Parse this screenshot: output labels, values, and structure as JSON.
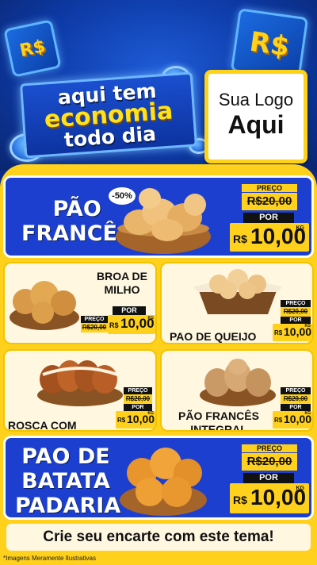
{
  "header": {
    "cube_left_text": "R$",
    "cube_right_text": "R$",
    "coin_text": "$",
    "headline_line1": "aqui tem",
    "headline_line2": "economia",
    "headline_line3": "todo dia",
    "logo_line1": "Sua Logo",
    "logo_line2": "Aqui"
  },
  "products": {
    "pao_frances": {
      "name_line1": "PÃO",
      "name_line2": "FRANCÊS",
      "discount": "-50%",
      "preco_label": "PREÇO",
      "old_price": "R$20,00",
      "por_label": "POR",
      "currency": "R$",
      "price": "10,00",
      "unit": "KG"
    },
    "broa": {
      "name_line1": "BROA DE",
      "name_line2": "MILHO",
      "preco_label": "PREÇO",
      "old_price": "R$20,00",
      "por_label": "POR",
      "currency": "R$",
      "price": "10,00",
      "unit": "KG"
    },
    "queijo": {
      "name": "PAO DE QUEIJO",
      "preco_label": "PREÇO",
      "old_price": "R$20,00",
      "por_label": "POR",
      "currency": "R$",
      "price": "10,00",
      "unit": "KG"
    },
    "rosca": {
      "name": "ROSCA COM CREME",
      "preco_label": "PREÇO",
      "old_price": "R$20,00",
      "por_label": "POR",
      "currency": "R$",
      "price": "10,00",
      "unit": "KG"
    },
    "integral": {
      "name_line1": "PÃO FRANCÊS",
      "name_line2": "INTEGRAL",
      "preco_label": "PREÇO",
      "old_price": "R$20,00",
      "por_label": "POR",
      "currency": "R$",
      "price": "10,00",
      "unit": "KG"
    },
    "batata": {
      "name_line1": "PAO DE",
      "name_line2": "BATATA",
      "name_line3": "PADARIA",
      "preco_label": "PREÇO",
      "old_price": "R$20,00",
      "por_label": "POR",
      "currency": "R$",
      "price": "10,00",
      "unit": "KG"
    }
  },
  "footer": {
    "cta": "Crie seu encarte com este tema!",
    "disclaimer": "*Imagens Meramente Ilustrativas"
  },
  "colors": {
    "brand_blue": "#1c3fcf",
    "brand_yellow": "#ffd01c",
    "cream": "#fff7e0"
  }
}
